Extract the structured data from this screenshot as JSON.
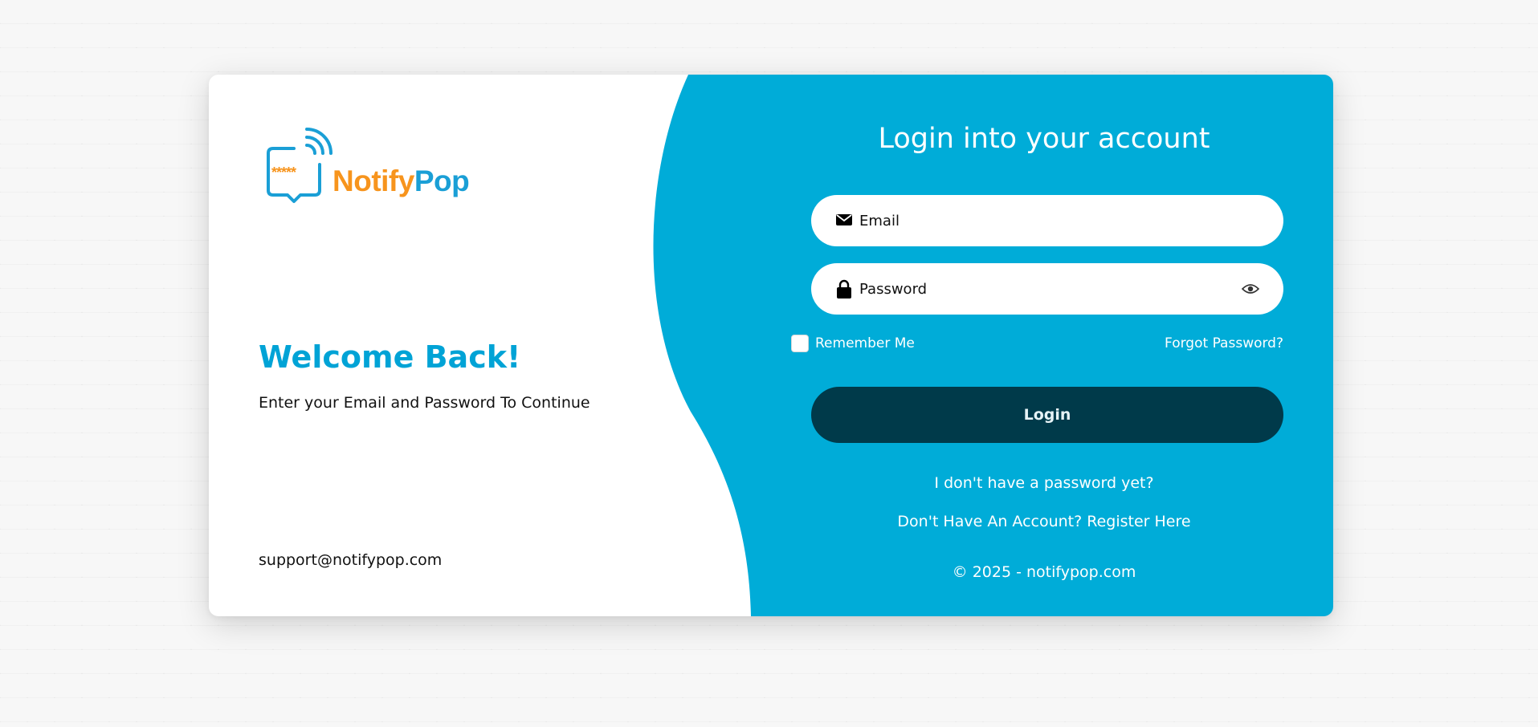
{
  "brand": {
    "name_part1": "Notify",
    "name_part2": "Pop",
    "stars": "*****",
    "colors": {
      "primary_blue": "#00acd8",
      "orange": "#f7941d",
      "logo_blue": "#1a9fd6",
      "button_dark": "#003a4a"
    }
  },
  "left_panel": {
    "welcome_title": "Welcome Back!",
    "subtitle": "Enter your Email and Password To Continue",
    "support_email": "support@notifypop.com"
  },
  "login_form": {
    "title": "Login into your account",
    "email_placeholder": "Email",
    "email_icon": "envelope-icon",
    "password_placeholder": "Password",
    "password_icon": "lock-icon",
    "show_password_icon": "eye-icon",
    "remember_me_label": "Remember Me",
    "remember_me_checked": false,
    "forgot_password_label": "Forgot Password?",
    "login_button_label": "Login",
    "no_password_link": "I don't have a password yet?",
    "register_link": "Don't Have An Account? Register Here",
    "copyright": "© 2025 - notifypop.com"
  }
}
